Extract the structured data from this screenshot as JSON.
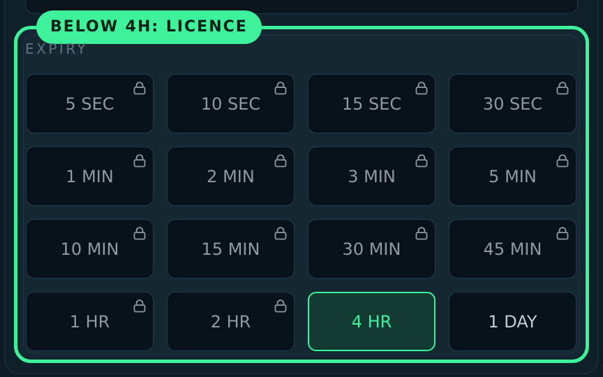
{
  "badge": {
    "label": "BELOW 4H: LICENCE"
  },
  "section": {
    "label": "EXPIRY"
  },
  "options": [
    {
      "label": "5 SEC",
      "locked": true
    },
    {
      "label": "10 SEC",
      "locked": true
    },
    {
      "label": "15 SEC",
      "locked": true
    },
    {
      "label": "30 SEC",
      "locked": true
    },
    {
      "label": "1 MIN",
      "locked": true
    },
    {
      "label": "2 MIN",
      "locked": true
    },
    {
      "label": "3 MIN",
      "locked": true
    },
    {
      "label": "5 MIN",
      "locked": true
    },
    {
      "label": "10 MIN",
      "locked": true
    },
    {
      "label": "15 MIN",
      "locked": true
    },
    {
      "label": "30 MIN",
      "locked": true
    },
    {
      "label": "45 MIN",
      "locked": true
    },
    {
      "label": "1 HR",
      "locked": true
    },
    {
      "label": "2 HR",
      "locked": true
    },
    {
      "label": "4 HR",
      "locked": false,
      "selected": true
    },
    {
      "label": "1 DAY",
      "locked": false
    }
  ],
  "colors": {
    "accent": "#3df29b",
    "tile_bg": "#07111a",
    "selected_bg": "#123b33",
    "panel_bg": "#142832"
  },
  "icons": {
    "lock": "lock-icon"
  }
}
